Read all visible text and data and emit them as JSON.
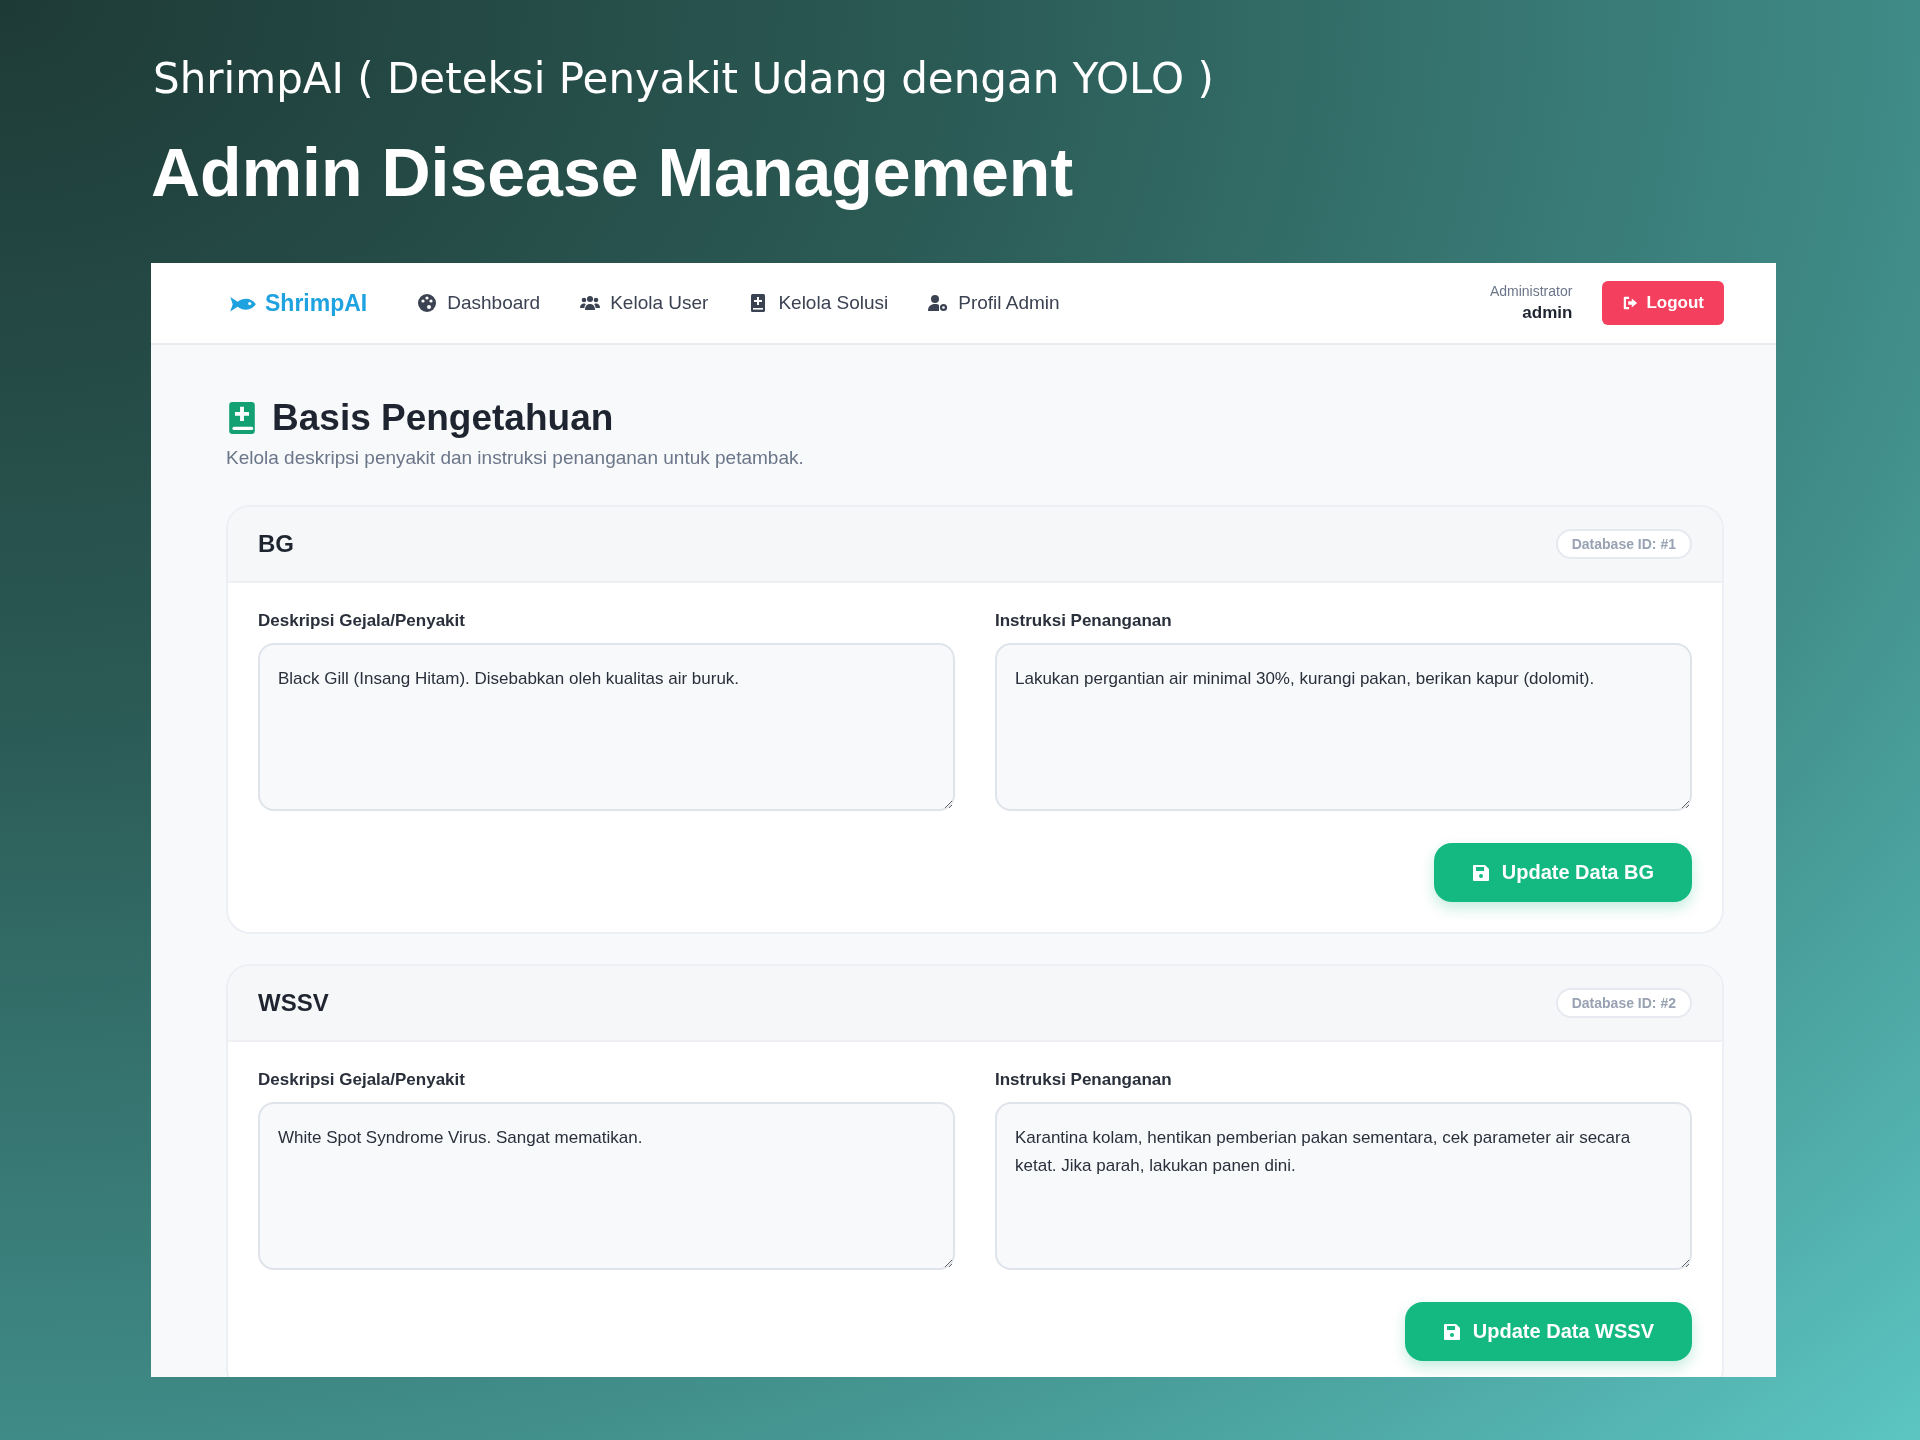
{
  "banner": {
    "subtitle": "ShrimpAI ( Deteksi Penyakit Udang dengan YOLO )",
    "title": "Admin Disease Management"
  },
  "navbar": {
    "brand": "ShrimpAI",
    "items": [
      {
        "label": "Dashboard"
      },
      {
        "label": "Kelola User"
      },
      {
        "label": "Kelola Solusi"
      },
      {
        "label": "Profil Admin"
      }
    ],
    "user": {
      "role": "Administrator",
      "name": "admin"
    },
    "logout": "Logout"
  },
  "page": {
    "title": "Basis Pengetahuan",
    "subtitle": "Kelola deskripsi penyakit dan instruksi penanganan untuk petambak."
  },
  "diseases": [
    {
      "code": "BG",
      "badge": "Database ID: #1",
      "description_label": "Deskripsi Gejala/Penyakit",
      "description": "Black Gill (Insang Hitam). Disebabkan oleh kualitas air buruk.",
      "instruction_label": "Instruksi Penanganan",
      "instruction": "Lakukan pergantian air minimal 30%, kurangi pakan, berikan kapur (dolomit).",
      "button": "Update Data BG"
    },
    {
      "code": "WSSV",
      "badge": "Database ID: #2",
      "description_label": "Deskripsi Gejala/Penyakit",
      "description": "White Spot Syndrome Virus. Sangat mematikan.",
      "instruction_label": "Instruksi Penanganan",
      "instruction": "Karantina kolam, hentikan pemberian pakan sementara, cek parameter air secara ketat. Jika parah, lakukan panen dini.",
      "button": "Update Data WSSV"
    }
  ]
}
